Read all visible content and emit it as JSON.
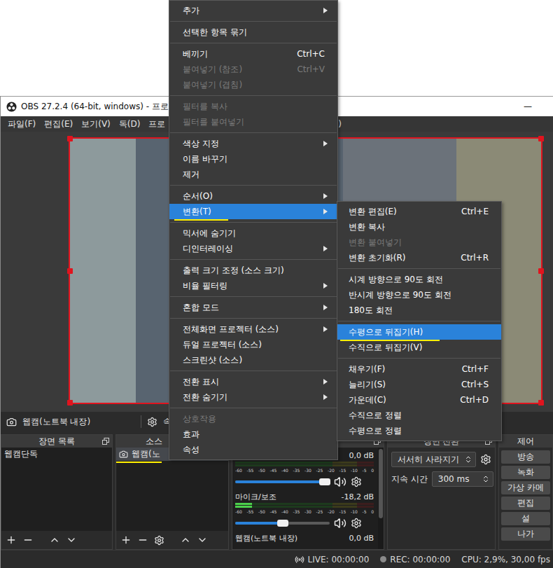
{
  "window": {
    "title": "OBS 27.2.4 (64-bit, windows) - 프로파",
    "minimize": "—"
  },
  "menubar": {
    "items": [
      "파일(F)",
      "편집(E)",
      "보기(V)",
      "독(D)",
      "프로"
    ],
    "tail": ")"
  },
  "preview": {
    "selected": true
  },
  "source_toolbar": {
    "source": "웹캠(노트북 내장)",
    "properties": "속"
  },
  "scenes": {
    "title": "장면 목록",
    "items": [
      {
        "name": "웹캠단독",
        "selected": false
      }
    ]
  },
  "sources": {
    "title": "소스",
    "items": [
      {
        "name": "웹캠(노",
        "selected": true,
        "marked": true
      }
    ]
  },
  "mixer": {
    "ticks": [
      "-60",
      "-55",
      "-50",
      "-45",
      "-40",
      "-35",
      "-30",
      "-25",
      "-20",
      "-15",
      "-10",
      "-5",
      "0"
    ],
    "channels": [
      {
        "reading": "0,0 dB",
        "meter": 0,
        "level": 0.95,
        "muted": false
      },
      {
        "name": "마이크/보조",
        "reading": "-18,2 dB",
        "meter": 0.12,
        "level": 0.5,
        "muted": false
      },
      {
        "name": "웹캠(노트북 내장)",
        "reading": "0,0 dB"
      }
    ]
  },
  "transitions": {
    "title": "장면 전환",
    "transition": "서서히 사라지기",
    "duration_label": "지속 시간",
    "duration": "300 ms"
  },
  "controls": {
    "title": "제어",
    "buttons": [
      "방송",
      "녹화",
      "가상 카메",
      "편집",
      "설",
      "나가"
    ]
  },
  "status_bar": {
    "live": "LIVE: 00:00:00",
    "rec": "REC: 00:00:00",
    "cpu": "CPU: 2,9%, 30,00 fps"
  },
  "context_menu": {
    "items": [
      {
        "kind": "item",
        "label": "추가",
        "submenu": true,
        "disabled": false,
        "selected": false,
        "marked": false
      },
      {
        "kind": "separator"
      },
      {
        "kind": "item",
        "label": "선택한 항목 묶기",
        "submenu": false,
        "disabled": false,
        "selected": false,
        "marked": false
      },
      {
        "kind": "separator"
      },
      {
        "kind": "item",
        "label": "베끼기",
        "shortcut": "Ctrl+C",
        "submenu": false,
        "disabled": false,
        "selected": false,
        "marked": false
      },
      {
        "kind": "item",
        "label": "붙여넣기 (참조)",
        "shortcut": "Ctrl+V",
        "submenu": false,
        "disabled": true,
        "selected": false,
        "marked": false
      },
      {
        "kind": "item",
        "label": "붙여넣기 (겹침)",
        "submenu": false,
        "disabled": true,
        "selected": false,
        "marked": false
      },
      {
        "kind": "separator"
      },
      {
        "kind": "item",
        "label": "필터를 복사",
        "submenu": false,
        "disabled": true,
        "selected": false,
        "marked": false
      },
      {
        "kind": "item",
        "label": "필터를 붙여넣기",
        "submenu": false,
        "disabled": true,
        "selected": false,
        "marked": false
      },
      {
        "kind": "separator"
      },
      {
        "kind": "item",
        "label": "색상 지정",
        "submenu": true,
        "disabled": false,
        "selected": false,
        "marked": false
      },
      {
        "kind": "item",
        "label": "이름 바꾸기",
        "submenu": false,
        "disabled": false,
        "selected": false,
        "marked": false
      },
      {
        "kind": "item",
        "label": "제거",
        "submenu": false,
        "disabled": false,
        "selected": false,
        "marked": false
      },
      {
        "kind": "separator"
      },
      {
        "kind": "item",
        "label": "순서(O)",
        "submenu": true,
        "disabled": false,
        "selected": false,
        "marked": false
      },
      {
        "kind": "item",
        "label": "변환(T)",
        "submenu": true,
        "disabled": false,
        "selected": true,
        "marked": true
      },
      {
        "kind": "separator"
      },
      {
        "kind": "item",
        "label": "믹서에 숨기기",
        "submenu": false,
        "disabled": false,
        "selected": false,
        "marked": false
      },
      {
        "kind": "item",
        "label": "디인터레이싱",
        "submenu": true,
        "disabled": false,
        "selected": false,
        "marked": false
      },
      {
        "kind": "separator"
      },
      {
        "kind": "item",
        "label": "출력 크기 조정 (소스 크기)",
        "submenu": false,
        "disabled": false,
        "selected": false,
        "marked": false
      },
      {
        "kind": "item",
        "label": "비율 필터링",
        "submenu": true,
        "disabled": false,
        "selected": false,
        "marked": false
      },
      {
        "kind": "separator"
      },
      {
        "kind": "item",
        "label": "혼합 모드",
        "submenu": true,
        "disabled": false,
        "selected": false,
        "marked": false
      },
      {
        "kind": "separator"
      },
      {
        "kind": "item",
        "label": "전체화면 프로젝터 (소스)",
        "submenu": true,
        "disabled": false,
        "selected": false,
        "marked": false
      },
      {
        "kind": "item",
        "label": "듀얼 프로젝터 (소스)",
        "submenu": false,
        "disabled": false,
        "selected": false,
        "marked": false
      },
      {
        "kind": "item",
        "label": "스크린샷 (소스)",
        "submenu": false,
        "disabled": false,
        "selected": false,
        "marked": false
      },
      {
        "kind": "separator"
      },
      {
        "kind": "item",
        "label": "전환 표시",
        "submenu": true,
        "disabled": false,
        "selected": false,
        "marked": false
      },
      {
        "kind": "item",
        "label": "전환 숨기기",
        "submenu": true,
        "disabled": false,
        "selected": false,
        "marked": false
      },
      {
        "kind": "separator"
      },
      {
        "kind": "item",
        "label": "상호작용",
        "submenu": false,
        "disabled": true,
        "selected": false,
        "marked": false
      },
      {
        "kind": "item",
        "label": "효과",
        "submenu": false,
        "disabled": false,
        "selected": false,
        "marked": false
      },
      {
        "kind": "item",
        "label": "속성",
        "submenu": false,
        "disabled": false,
        "selected": false,
        "marked": false
      }
    ]
  },
  "transform_menu": {
    "items": [
      {
        "kind": "item",
        "label": "변환 편집(E)",
        "shortcut": "Ctrl+E",
        "submenu": false,
        "disabled": false,
        "selected": false,
        "marked": false
      },
      {
        "kind": "item",
        "label": "변환 복사",
        "submenu": false,
        "disabled": false,
        "selected": false,
        "marked": false
      },
      {
        "kind": "item",
        "label": "변환 붙여넣기",
        "submenu": false,
        "disabled": true,
        "selected": false,
        "marked": false
      },
      {
        "kind": "item",
        "label": "변환 초기화(R)",
        "shortcut": "Ctrl+R",
        "submenu": false,
        "disabled": false,
        "selected": false,
        "marked": false
      },
      {
        "kind": "separator"
      },
      {
        "kind": "item",
        "label": "시계 방향으로 90도 회전",
        "submenu": false,
        "disabled": false,
        "selected": false,
        "marked": false
      },
      {
        "kind": "item",
        "label": "반시계 방향으로 90도 회전",
        "submenu": false,
        "disabled": false,
        "selected": false,
        "marked": false
      },
      {
        "kind": "item",
        "label": "180도 회전",
        "submenu": false,
        "disabled": false,
        "selected": false,
        "marked": false
      },
      {
        "kind": "separator"
      },
      {
        "kind": "item",
        "label": "수평으로 뒤집기(H)",
        "submenu": false,
        "disabled": false,
        "selected": true,
        "marked": true
      },
      {
        "kind": "item",
        "label": "수직으로 뒤집기(V)",
        "submenu": false,
        "disabled": false,
        "selected": false,
        "marked": false
      },
      {
        "kind": "separator"
      },
      {
        "kind": "item",
        "label": "채우기(F)",
        "shortcut": "Ctrl+F",
        "submenu": false,
        "disabled": false,
        "selected": false,
        "marked": false
      },
      {
        "kind": "item",
        "label": "늘리기(S)",
        "shortcut": "Ctrl+S",
        "submenu": false,
        "disabled": false,
        "selected": false,
        "marked": false
      },
      {
        "kind": "item",
        "label": "가운데(C)",
        "shortcut": "Ctrl+D",
        "submenu": false,
        "disabled": false,
        "selected": false,
        "marked": false
      },
      {
        "kind": "item",
        "label": "수직으로 정렬",
        "submenu": false,
        "disabled": false,
        "selected": false,
        "marked": false
      },
      {
        "kind": "item",
        "label": "수평으로 정렬",
        "submenu": false,
        "disabled": false,
        "selected": false,
        "marked": false
      }
    ]
  }
}
